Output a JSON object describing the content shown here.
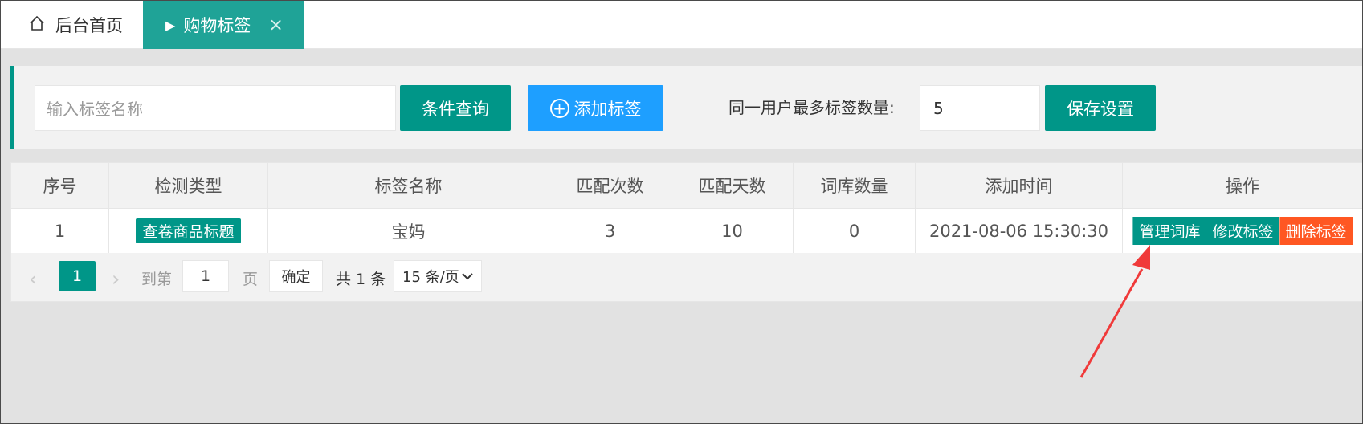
{
  "tabs": {
    "home_label": "后台首页",
    "active_label": "购物标签",
    "close_icon": "×"
  },
  "search": {
    "placeholder": "输入标签名称",
    "query_button": "条件查询",
    "add_button": "添加标签",
    "max_label": "同一用户最多标签数量:",
    "max_value": "5",
    "save_button": "保存设置"
  },
  "table": {
    "headers": [
      "序号",
      "检测类型",
      "标签名称",
      "匹配次数",
      "匹配天数",
      "词库数量",
      "添加时间",
      "操作"
    ],
    "rows": [
      {
        "index": "1",
        "type": "查卷商品标题",
        "name": "宝妈",
        "match_count": "3",
        "match_days": "10",
        "lexicon_count": "0",
        "added_time": "2021-08-06 15:30:30",
        "ops": [
          "管理词库",
          "修改标签",
          "删除标签"
        ]
      }
    ]
  },
  "pagination": {
    "current_page": "1",
    "goto_label": "到第",
    "goto_value": "1",
    "page_unit": "页",
    "confirm": "确定",
    "total": "共 1 条",
    "page_size": "15 条/页"
  },
  "colors": {
    "primary": "#009688",
    "blue": "#1e9fff",
    "danger": "#ff5722",
    "annotation_arrow": "#f03a3a"
  },
  "icons": {
    "home": "home-icon",
    "play": "play-icon",
    "close": "close-icon",
    "add": "plus-circle-icon",
    "prev": "chevron-left-icon",
    "next": "chevron-right-icon",
    "dropdown": "chevron-down-icon"
  }
}
